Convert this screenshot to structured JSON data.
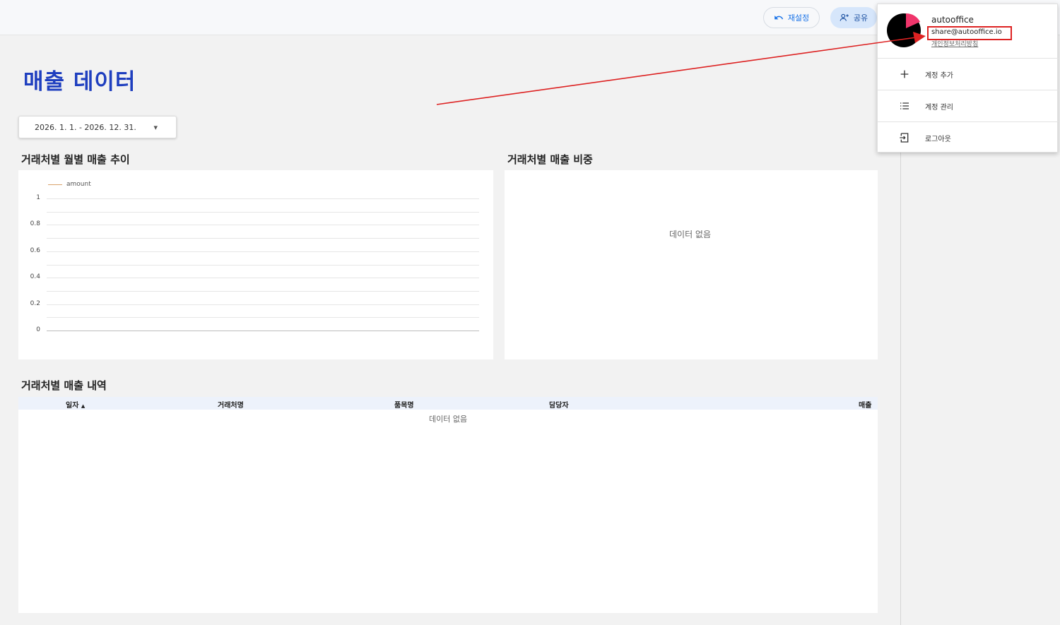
{
  "toolbar": {
    "reset_label": "재설정",
    "share_label": "공유"
  },
  "page": {
    "title": "매출 데이터"
  },
  "date_filter": {
    "value": "2026. 1. 1. - 2026. 12. 31.",
    "caret": "▾"
  },
  "sections": {
    "monthly_trend": "거래처별 월별 매출 추이",
    "share_chart": "거래처별 매출 비중",
    "sales_table": "거래처별 매출 내역"
  },
  "chart_data": {
    "type": "line",
    "series": [
      {
        "name": "amount",
        "values": []
      }
    ],
    "x": [],
    "yticks": [
      "1",
      "0.8",
      "0.6",
      "0.4",
      "0.2",
      "0"
    ],
    "ylim": [
      0,
      1
    ],
    "legend_position": "top-left",
    "grid": true,
    "series_color": "#d9a36b"
  },
  "pie": {
    "empty_text": "데이터 없음"
  },
  "table": {
    "columns": [
      "일자",
      "거래처명",
      "품목명",
      "담당자",
      "매출"
    ],
    "sort_indicator": "▲",
    "rows": [],
    "empty_text": "데이터 없음"
  },
  "account_menu": {
    "name": "autooffice",
    "email": "share@autooffice.io",
    "privacy": "개인정보처리방침",
    "items": [
      {
        "label": "계정 추가",
        "icon": "plus-icon"
      },
      {
        "label": "계정 관리",
        "icon": "list-icon"
      },
      {
        "label": "로그아웃",
        "icon": "logout-icon"
      }
    ]
  },
  "colors": {
    "title": "#1f3fbf",
    "accent": "#1a73e8",
    "annotation": "#dd2222"
  }
}
